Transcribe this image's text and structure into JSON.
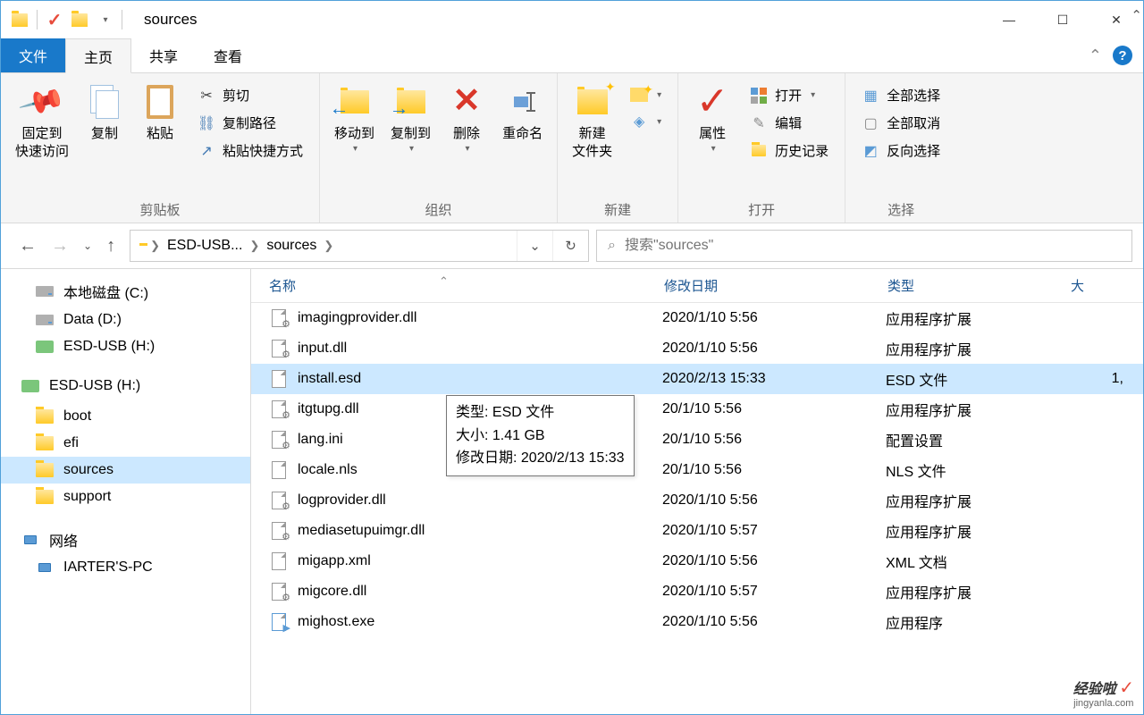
{
  "title": "sources",
  "tabs": {
    "file": "文件",
    "home": "主页",
    "share": "共享",
    "view": "查看"
  },
  "ribbon": {
    "clipboard": {
      "label": "剪贴板",
      "pin": "固定到\n快速访问",
      "copy": "复制",
      "paste": "粘贴",
      "cut": "剪切",
      "copy_path": "复制路径",
      "paste_shortcut": "粘贴快捷方式"
    },
    "organize": {
      "label": "组织",
      "move_to": "移动到",
      "copy_to": "复制到",
      "delete": "删除",
      "rename": "重命名"
    },
    "new": {
      "label": "新建",
      "new_folder": "新建\n文件夹",
      "new_item": "",
      "new_item2": ""
    },
    "open": {
      "label": "打开",
      "properties": "属性",
      "open": "打开",
      "edit": "编辑",
      "history": "历史记录"
    },
    "select": {
      "label": "选择",
      "select_all": "全部选择",
      "select_none": "全部取消",
      "invert": "反向选择"
    }
  },
  "breadcrumb": {
    "drive": "ESD-USB...",
    "folder": "sources"
  },
  "search_placeholder": "搜索\"sources\"",
  "nav": {
    "c_drive": "本地磁盘 (C:)",
    "d_drive": "Data (D:)",
    "h_drive": "ESD-USB (H:)",
    "boot": "boot",
    "efi": "efi",
    "sources": "sources",
    "support": "support",
    "network": "网络",
    "pc": "IARTER'S-PC"
  },
  "columns": {
    "name": "名称",
    "date": "修改日期",
    "type": "类型",
    "size": "大"
  },
  "files": [
    {
      "name": "imagingprovider.dll",
      "date": "2020/1/10 5:56",
      "type": "应用程序扩展",
      "size": "",
      "icon": "dll"
    },
    {
      "name": "input.dll",
      "date": "2020/1/10 5:56",
      "type": "应用程序扩展",
      "size": "",
      "icon": "dll"
    },
    {
      "name": "install.esd",
      "date": "2020/2/13 15:33",
      "type": "ESD 文件",
      "size": "1,",
      "icon": "file",
      "selected": true
    },
    {
      "name": "itgtupg.dll",
      "date": "20/1/10 5:56",
      "type": "应用程序扩展",
      "size": "",
      "icon": "dll"
    },
    {
      "name": "lang.ini",
      "date": "20/1/10 5:56",
      "type": "配置设置",
      "size": "",
      "icon": "ini"
    },
    {
      "name": "locale.nls",
      "date": "20/1/10 5:56",
      "type": "NLS 文件",
      "size": "",
      "icon": "file"
    },
    {
      "name": "logprovider.dll",
      "date": "2020/1/10 5:56",
      "type": "应用程序扩展",
      "size": "",
      "icon": "dll"
    },
    {
      "name": "mediasetupuimgr.dll",
      "date": "2020/1/10 5:57",
      "type": "应用程序扩展",
      "size": "",
      "icon": "dll"
    },
    {
      "name": "migapp.xml",
      "date": "2020/1/10 5:56",
      "type": "XML 文档",
      "size": "",
      "icon": "file"
    },
    {
      "name": "migcore.dll",
      "date": "2020/1/10 5:57",
      "type": "应用程序扩展",
      "size": "",
      "icon": "dll"
    },
    {
      "name": "mighost.exe",
      "date": "2020/1/10 5:56",
      "type": "应用程序",
      "size": "",
      "icon": "exe"
    }
  ],
  "tooltip": {
    "line1": "类型: ESD 文件",
    "line2": "大小: 1.41 GB",
    "line3": "修改日期: 2020/2/13 15:33"
  },
  "watermark": {
    "brand": "经验啦",
    "url": "jingyanla.com"
  }
}
